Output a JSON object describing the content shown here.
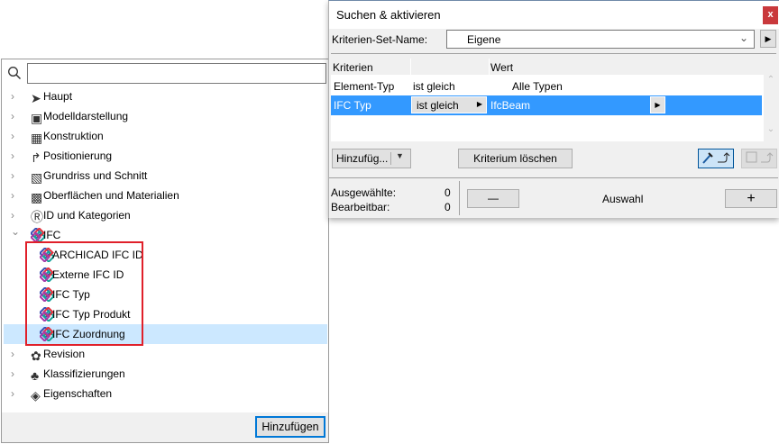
{
  "left_panel": {
    "search": {
      "value": "",
      "placeholder": ""
    },
    "items": [
      {
        "label": "Haupt",
        "icon": "pointer-arrow-icon",
        "expanded": false
      },
      {
        "label": "Modelldarstellung",
        "icon": "monitor-icon",
        "expanded": false
      },
      {
        "label": "Konstruktion",
        "icon": "bricks-icon",
        "expanded": false
      },
      {
        "label": "Positionierung",
        "icon": "positioning-icon",
        "expanded": false
      },
      {
        "label": "Grundriss und Schnitt",
        "icon": "floorplan-section-icon",
        "expanded": false
      },
      {
        "label": "Oberflächen und Materialien",
        "icon": "surfaces-materials-icon",
        "expanded": false
      },
      {
        "label": "ID und Kategorien",
        "icon": "id-circle-icon",
        "expanded": false
      },
      {
        "label": "IFC",
        "icon": "ifc-logo-icon",
        "expanded": true,
        "children": [
          {
            "label": "ARCHICAD IFC ID"
          },
          {
            "label": "Externe IFC ID"
          },
          {
            "label": "IFC Typ"
          },
          {
            "label": "IFC Typ Produkt"
          },
          {
            "label": "IFC Zuordnung",
            "selected": true
          }
        ]
      },
      {
        "label": "Revision",
        "icon": "revision-icon",
        "expanded": false
      },
      {
        "label": "Klassifizierungen",
        "icon": "tree-icon",
        "expanded": false
      },
      {
        "label": "Eigenschaften",
        "icon": "tags-icon",
        "expanded": false
      }
    ],
    "add_button": "Hinzufügen"
  },
  "dialog": {
    "title": "Suchen & aktivieren",
    "close_label": "x",
    "set_name_label": "Kriterien-Set-Name:",
    "set_name_value": "Eigene",
    "table": {
      "headers": [
        "Kriterien",
        "",
        "Wert"
      ],
      "rows": [
        {
          "criterion": "Element-Typ",
          "operator": "ist gleich",
          "value": "Alle Typen"
        },
        {
          "criterion": "IFC Typ",
          "operator": "ist gleich",
          "value": "IfcBeam",
          "selected": true
        }
      ]
    },
    "add_button": "Hinzufüg...",
    "delete_button": "Kriterium löschen",
    "selected_label": "Ausgewählte:",
    "selected_count": "0",
    "editable_label": "Bearbeitbar:",
    "editable_count": "0",
    "minus_label": "—",
    "selection_label": "Auswahl",
    "plus_label": "+"
  },
  "colors": {
    "selection_blue": "#3399ff",
    "tree_highlight": "#cce8ff",
    "highlight_box": "#e0202a",
    "close_red": "#c9393c"
  }
}
